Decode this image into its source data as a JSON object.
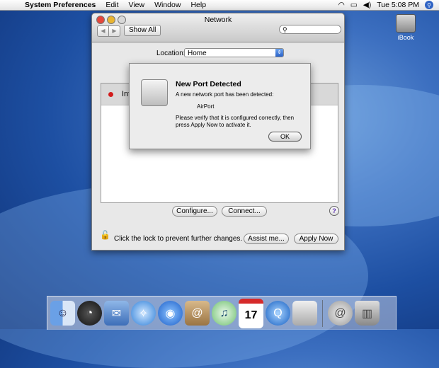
{
  "menubar": {
    "apple": "",
    "app": "System Preferences",
    "items": [
      "Edit",
      "View",
      "Window",
      "Help"
    ],
    "time": "Tue 5:08 PM"
  },
  "desktop": {
    "hd_label": "iBook"
  },
  "window": {
    "title": "Network",
    "show_all": "Show All",
    "location_label": "Location:",
    "location_value": "Home",
    "list_row": "Inte",
    "configure": "Configure...",
    "connect": "Connect...",
    "lock_text": "Click the lock to prevent further changes.",
    "assist": "Assist me...",
    "apply": "Apply Now"
  },
  "sheet": {
    "title": "New Port Detected",
    "line1": "A new network port has been detected:",
    "port": "AirPort",
    "line2": "Please verify that it is configured correctly, then press Apply Now to activate it.",
    "ok": "OK"
  },
  "dock": {
    "items": [
      "finder",
      "dashboard",
      "mail",
      "safari",
      "ichat",
      "address-book",
      "itunes",
      "ical",
      "quicktime",
      "system-preferences",
      "mail-alt",
      "trash"
    ],
    "ical_day": "17"
  }
}
